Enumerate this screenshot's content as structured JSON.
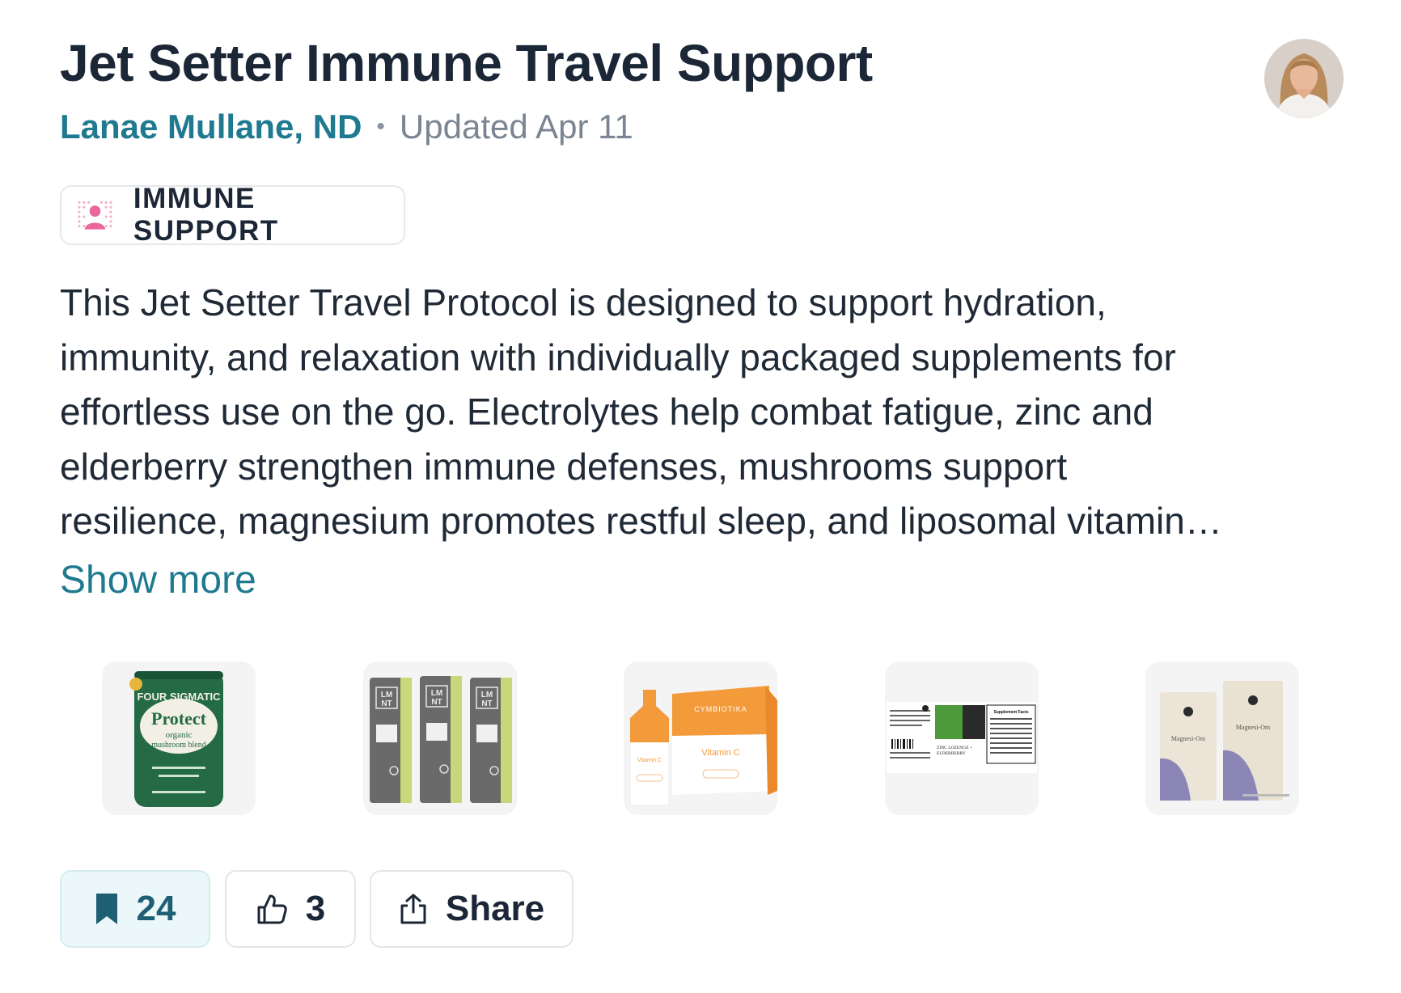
{
  "protocol": {
    "title": "Jet Setter Immune Travel Support",
    "author": "Lanae Mullane, ND",
    "separator": "•",
    "updated": "Updated Apr 11",
    "tag": "IMMUNE SUPPORT",
    "description_lines": [
      "This Jet Setter Travel Protocol is designed to support hydration,",
      "immunity, and relaxation with individually packaged supplements for",
      "effortless use on the go. Electrolytes help combat fatigue, zinc and",
      "elderberry strengthen immune defenses, mushrooms support",
      "resilience, magnesium promotes restful sleep, and liposomal vitamin…"
    ],
    "show_more": "Show more"
  },
  "products": [
    {
      "name": "Four Sigmatic Protect organic mushroom blend",
      "label_lines": [
        "FOUR SIGMATIC",
        "Protect",
        "organic",
        "mushroom blend"
      ]
    },
    {
      "name": "LMNT electrolyte packets",
      "label_lines": [
        "LM",
        "NT"
      ]
    },
    {
      "name": "Cymbiotika Liposomal Vitamin C",
      "label_lines": [
        "CYMBIOTIKA",
        "Vitamin C"
      ]
    },
    {
      "name": "Zinc Lozenge + Elderberry",
      "label_lines": [
        "ZINC LOZENGE +",
        "ELDERBERRY",
        "Supplement Facts"
      ]
    },
    {
      "name": "Magnesi-Om",
      "label_lines": [
        "Magnesi-Om",
        "Magnesi-Om"
      ]
    }
  ],
  "actions": {
    "save_count": "24",
    "like_count": "3",
    "share_label": "Share"
  },
  "colors": {
    "accent": "#1f7a90",
    "title": "#1b2636",
    "muted": "#7a8591",
    "save_bg": "#ecf7f9",
    "tag_icon": "#e9679b"
  },
  "icons": {
    "tag": "person-dots-icon",
    "save": "bookmark-icon",
    "like": "thumbs-up-icon",
    "share": "share-icon"
  }
}
